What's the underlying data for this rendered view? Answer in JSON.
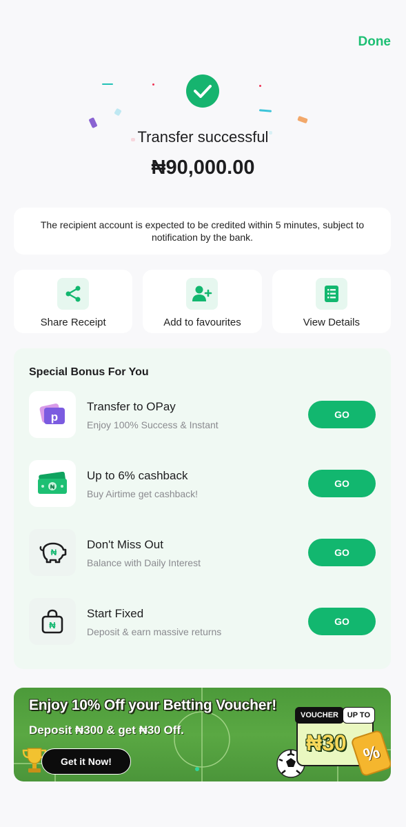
{
  "header": {
    "done_label": "Done"
  },
  "status": {
    "title": "Transfer successful",
    "amount": "₦90,000.00",
    "note": "The recipient account is expected to be credited within 5 minutes, subject to notification by the bank."
  },
  "actions": [
    {
      "label": "Share Receipt",
      "icon": "share-icon"
    },
    {
      "label": "Add to favourites",
      "icon": "add-user-icon"
    },
    {
      "label": "View Details",
      "icon": "list-icon"
    }
  ],
  "bonus": {
    "title": "Special Bonus For You",
    "items": [
      {
        "title": "Transfer to OPay",
        "subtitle": "Enjoy 100% Success & Instant",
        "button": "GO",
        "icon": "opay-wallet-icon"
      },
      {
        "title": "Up to 6% cashback",
        "subtitle": "Buy Airtime get cashback!",
        "button": "GO",
        "icon": "cash-icon"
      },
      {
        "title": "Don't Miss Out",
        "subtitle": "Balance with Daily Interest",
        "button": "GO",
        "icon": "piggy-bank-icon"
      },
      {
        "title": "Start Fixed",
        "subtitle": "Deposit & earn massive returns",
        "button": "GO",
        "icon": "lock-bag-icon"
      }
    ]
  },
  "banner": {
    "title": "Enjoy 10% Off your Betting Voucher!",
    "subtitle": "Deposit ₦300 & get ₦30 Off.",
    "cta": "Get it Now!",
    "voucher_tag": "VOUCHER",
    "voucher_upto": "UP TO",
    "voucher_amount": "₦30",
    "percent": "%"
  },
  "colors": {
    "accent": "#1dbf73",
    "button": "#12b76f",
    "bonus_bg": "#f0f9f3"
  }
}
